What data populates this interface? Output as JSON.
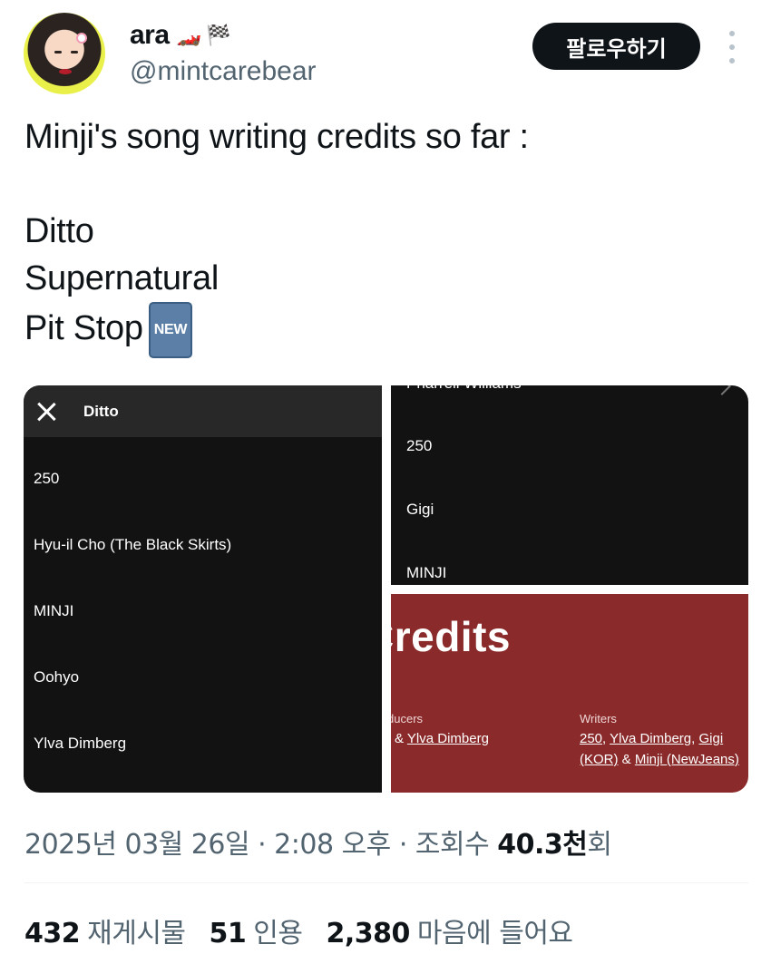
{
  "author": {
    "name": "ara",
    "name_emoji": "🏎️ 🏁",
    "handle": "@mintcarebear",
    "follow_label": "팔로우하기"
  },
  "tweet": {
    "lines": [
      "Minji's song writing credits so far :",
      "",
      "Ditto",
      "Supernatural",
      "Pit Stop"
    ],
    "new_badge": "NEW"
  },
  "media": {
    "left": {
      "title": "Ditto",
      "credits": [
        "250",
        "Hyu-il Cho (The Black Skirts)",
        "MINJI",
        "Oohyo",
        "Ylva Dimberg"
      ]
    },
    "top_right": {
      "cut_text": "Pharrell Williams",
      "credits": [
        "250",
        "Gigi",
        "MINJI"
      ]
    },
    "bottom_right": {
      "heading": "Credits",
      "producers_label": "ducers",
      "producers_value_prefix": "& ",
      "producers_value_link": "Ylva Dimberg",
      "writers_label": "Writers",
      "writers_1": "250",
      "writers_2": "Ylva Dimberg",
      "writers_3": "Gigi",
      "writers_4": "(KOR)",
      "writers_5": "Minji (NewJeans)"
    }
  },
  "meta": {
    "timestamp": "2025년 03월 26일 · 2:08 오후 · 조회수 ",
    "views": "40.3천",
    "views_suffix": "회"
  },
  "stats": {
    "reposts_count": "432",
    "reposts_label": "재게시물",
    "quotes_count": "51",
    "quotes_label": "인용",
    "likes_count": "2,380",
    "likes_label": "마음에 들어요"
  }
}
